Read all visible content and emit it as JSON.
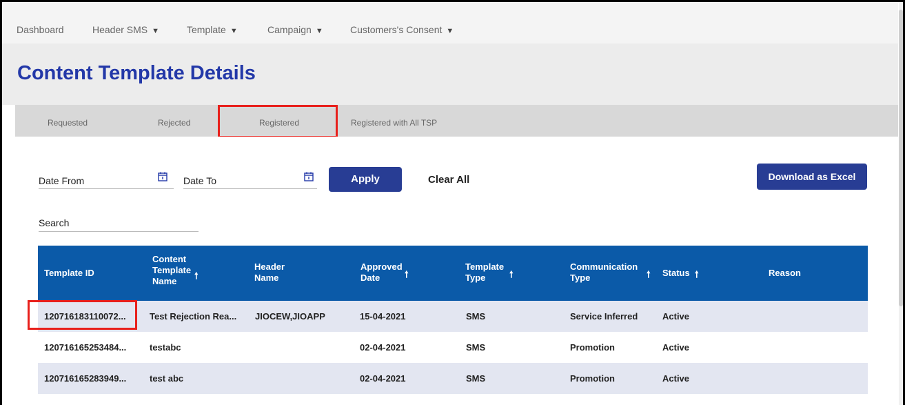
{
  "nav": {
    "items": [
      {
        "label": "Dashboard",
        "dropdown": false
      },
      {
        "label": "Header SMS",
        "dropdown": true
      },
      {
        "label": "Template",
        "dropdown": true
      },
      {
        "label": "Campaign",
        "dropdown": true
      },
      {
        "label": "Customers's Consent",
        "dropdown": true
      }
    ]
  },
  "page": {
    "title": "Content Template Details"
  },
  "tabs": [
    {
      "label": "Requested",
      "active": false
    },
    {
      "label": "Rejected",
      "active": false
    },
    {
      "label": "Registered",
      "active": true
    },
    {
      "label": "Registered with All TSP",
      "active": false
    }
  ],
  "filters": {
    "date_from_label": "Date From",
    "date_to_label": "Date To",
    "apply_label": "Apply",
    "clear_label": "Clear All",
    "download_label": "Download as Excel",
    "search_label": "Search"
  },
  "table": {
    "headers": {
      "template_id": "Template ID",
      "content_name_1": "Content",
      "content_name_2": "Template",
      "content_name_3": "Name",
      "header_name_1": "Header",
      "header_name_2": "Name",
      "approved_1": "Approved",
      "approved_2": "Date",
      "type_1": "Template",
      "type_2": "Type",
      "comm_1": "Communication",
      "comm_2": "Type",
      "status": "Status",
      "reason": "Reason"
    },
    "rows": [
      {
        "id": "120716183110072...",
        "name": "Test Rejection Rea...",
        "header": "JIOCEW,JIOAPP",
        "date": "15-04-2021",
        "type": "SMS",
        "comm": "Service Inferred",
        "status": "Active",
        "reason": ""
      },
      {
        "id": "120716165253484...",
        "name": "testabc",
        "header": "",
        "date": "02-04-2021",
        "type": "SMS",
        "comm": "Promotion",
        "status": "Active",
        "reason": ""
      },
      {
        "id": "120716165283949...",
        "name": "test abc",
        "header": "",
        "date": "02-04-2021",
        "type": "SMS",
        "comm": "Promotion",
        "status": "Active",
        "reason": ""
      }
    ]
  },
  "colors": {
    "accent": "#2338a8",
    "button": "#283d94",
    "table_header": "#0b5aa8",
    "highlight": "#e8201c",
    "row_alt": "#e3e6f1"
  },
  "icons": {
    "calendar": "calendar-icon",
    "sort": "sort-up-arrow-icon",
    "dropdown": "caret-down-icon"
  }
}
